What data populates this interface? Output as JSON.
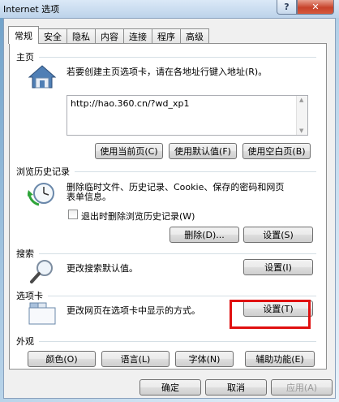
{
  "window": {
    "title": "Internet 选项",
    "help": "?",
    "close": "✕"
  },
  "tabs": [
    "常规",
    "安全",
    "隐私",
    "内容",
    "连接",
    "程序",
    "高级"
  ],
  "home": {
    "heading": "主页",
    "description": "若要创建主页选项卡，请在各地址行键入地址(R)。",
    "url": "http://hao.360.cn/?wd_xp1",
    "buttons": {
      "current": "使用当前页(C)",
      "default": "使用默认值(F)",
      "blank": "使用空白页(B)"
    }
  },
  "history": {
    "heading": "浏览历史记录",
    "description_line1": "删除临时文件、历史记录、Cookie、保存的密码和网页",
    "description_line2": "表单信息。",
    "checkbox_label": "退出时删除浏览历史记录(W)",
    "delete_button": "删除(D)...",
    "settings_button": "设置(S)"
  },
  "search": {
    "heading": "搜索",
    "description": "更改搜索默认值。",
    "settings_button": "设置(I)"
  },
  "tabs_section": {
    "heading": "选项卡",
    "description": "更改网页在选项卡中显示的方式。",
    "settings_button": "设置(T)"
  },
  "appearance": {
    "heading": "外观",
    "colors": "颜色(O)",
    "languages": "语言(L)",
    "fonts": "字体(N)",
    "accessibility": "辅助功能(E)"
  },
  "footer": {
    "ok": "确定",
    "cancel": "取消",
    "apply": "应用(A)"
  },
  "colors": {
    "highlight": "#e01010",
    "accent": "#8aa1bd"
  }
}
